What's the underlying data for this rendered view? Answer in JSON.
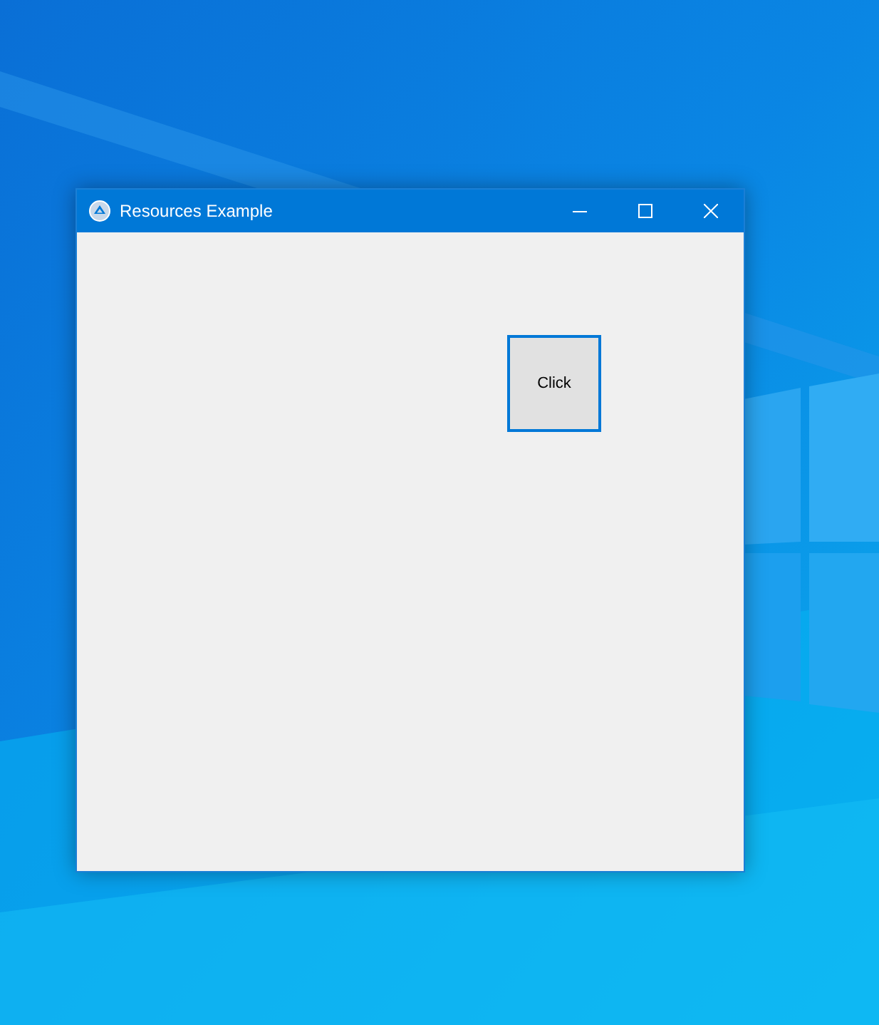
{
  "window": {
    "title": "Resources Example"
  },
  "buttons": [
    {
      "label": "Click",
      "focused": true
    }
  ]
}
